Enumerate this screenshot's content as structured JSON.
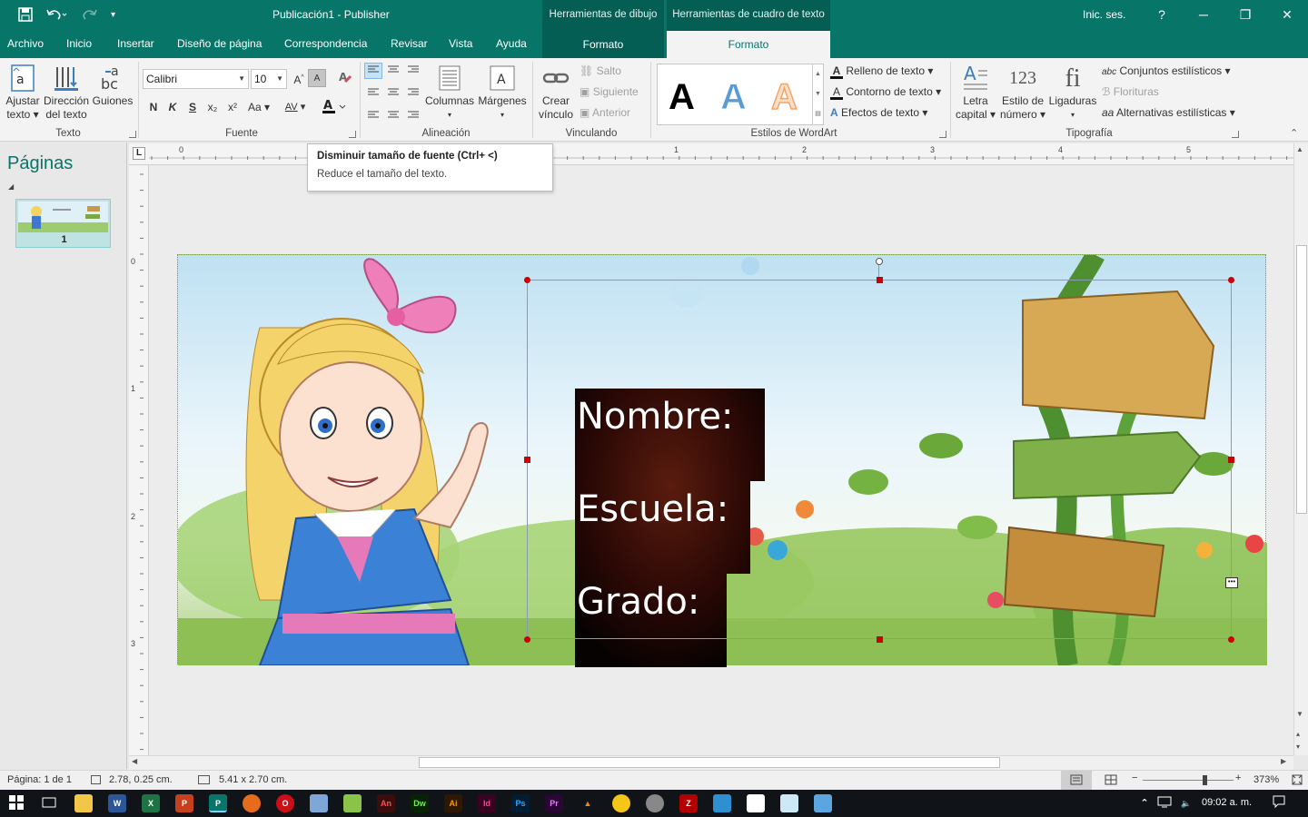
{
  "window": {
    "title": "Publicación1  -  Publisher",
    "sign_in": "Inic. ses.",
    "help": "?",
    "context_groups": [
      "Herramientas de dibujo",
      "Herramientas de cuadro de texto"
    ]
  },
  "tabs": [
    "Archivo",
    "Inicio",
    "Insertar",
    "Diseño de página",
    "Correspondencia",
    "Revisar",
    "Vista",
    "Ayuda"
  ],
  "context_tabs": [
    "Formato",
    "Formato"
  ],
  "ribbon": {
    "texto": {
      "label": "Texto",
      "fit_text": [
        "Ajustar",
        "texto"
      ],
      "text_direction": [
        "Dirección",
        "del texto"
      ],
      "hyphenation": "Guiones"
    },
    "fuente": {
      "label": "Fuente",
      "font_name": "Calibri",
      "font_size": "10",
      "bold": "N",
      "italic": "K",
      "strike": "S",
      "subscript": "x₂",
      "superscript": "x²",
      "change_case": "Aa",
      "spacing": "AV",
      "grow": "A",
      "shrink": "A"
    },
    "alineacion": {
      "label": "Alineación",
      "columns": "Columnas",
      "margins": "Márgenes"
    },
    "vinculando": {
      "label": "Vinculando",
      "create_link": [
        "Crear",
        "vínculo"
      ],
      "break": "Salto",
      "next": "Siguiente",
      "previous": "Anterior"
    },
    "wordart": {
      "label": "Estilos de WordArt",
      "samples": [
        "A",
        "A",
        "A"
      ],
      "fill": "Relleno de texto",
      "outline": "Contorno de texto",
      "effects": "Efectos de texto"
    },
    "tipografia": {
      "label": "Tipografía",
      "drop_cap": [
        "Letra",
        "capital"
      ],
      "number_style": [
        "Estilo de",
        "número"
      ],
      "number_icon": "123",
      "ligatures": "Ligaduras",
      "ligature_icon": "fi",
      "stylistic_sets": "Conjuntos estilísticos",
      "swashes": "Florituras",
      "alternates": "Alternativas estilísticas"
    }
  },
  "tooltip": {
    "title": "Disminuir tamaño de fuente (Ctrl+ <)",
    "description": "Reduce el tamaño del texto."
  },
  "pages_pane": {
    "title": "Páginas",
    "page_number": "1"
  },
  "rulers": {
    "h_numbers": [
      "0",
      "1",
      "2",
      "3",
      "4",
      "5"
    ],
    "v_numbers": [
      "0",
      "1",
      "2",
      "3"
    ],
    "corner": "L"
  },
  "document": {
    "labels": [
      "Nombre:",
      "Escuela:",
      "Grado:"
    ]
  },
  "status": {
    "page": "Página: 1 de 1",
    "position": "2.78, 0.25 cm.",
    "size": "5.41 x  2.70 cm.",
    "zoom": "373%"
  },
  "taskbar": {
    "clock": "09:02 a. m."
  },
  "colors": {
    "accent": "#077568",
    "context": "#055e54",
    "selection_handle": "#cc0000"
  }
}
